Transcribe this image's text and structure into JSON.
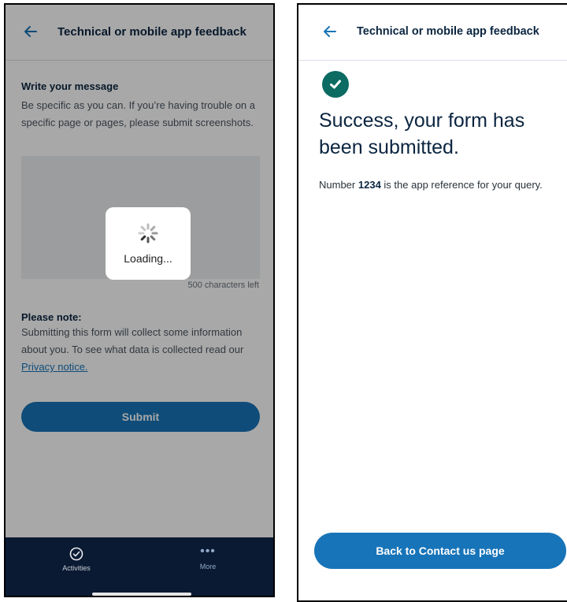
{
  "left_screen": {
    "header": {
      "title": "Technical or mobile app feedback"
    },
    "message_section": {
      "label": "Write your message",
      "description": "Be specific as you can. If you’re having trouble on a specific page or pages, please submit screenshots.",
      "characters_left": "500 characters left"
    },
    "note_section": {
      "label": "Please note:",
      "text": "Submitting this form will collect some information about you. To see what data is collected read our",
      "privacy_link": "Privacy notice."
    },
    "submit_label": "Submit",
    "loading_text": "Loading...",
    "tabbar": {
      "activities_label": "Activities",
      "more_label": "More"
    }
  },
  "right_screen": {
    "header": {
      "title": "Technical or mobile app feedback"
    },
    "success_heading": "Success, your form has been submitted.",
    "reference_prefix": "Number",
    "reference_number": "1234",
    "reference_suffix": "is the app reference for your query.",
    "back_button_label": "Back to Contact us page"
  },
  "colors": {
    "accent": "#1874b8",
    "success": "#0c6b62",
    "tabbar": "#0b1a33",
    "text": "#0b2540"
  }
}
